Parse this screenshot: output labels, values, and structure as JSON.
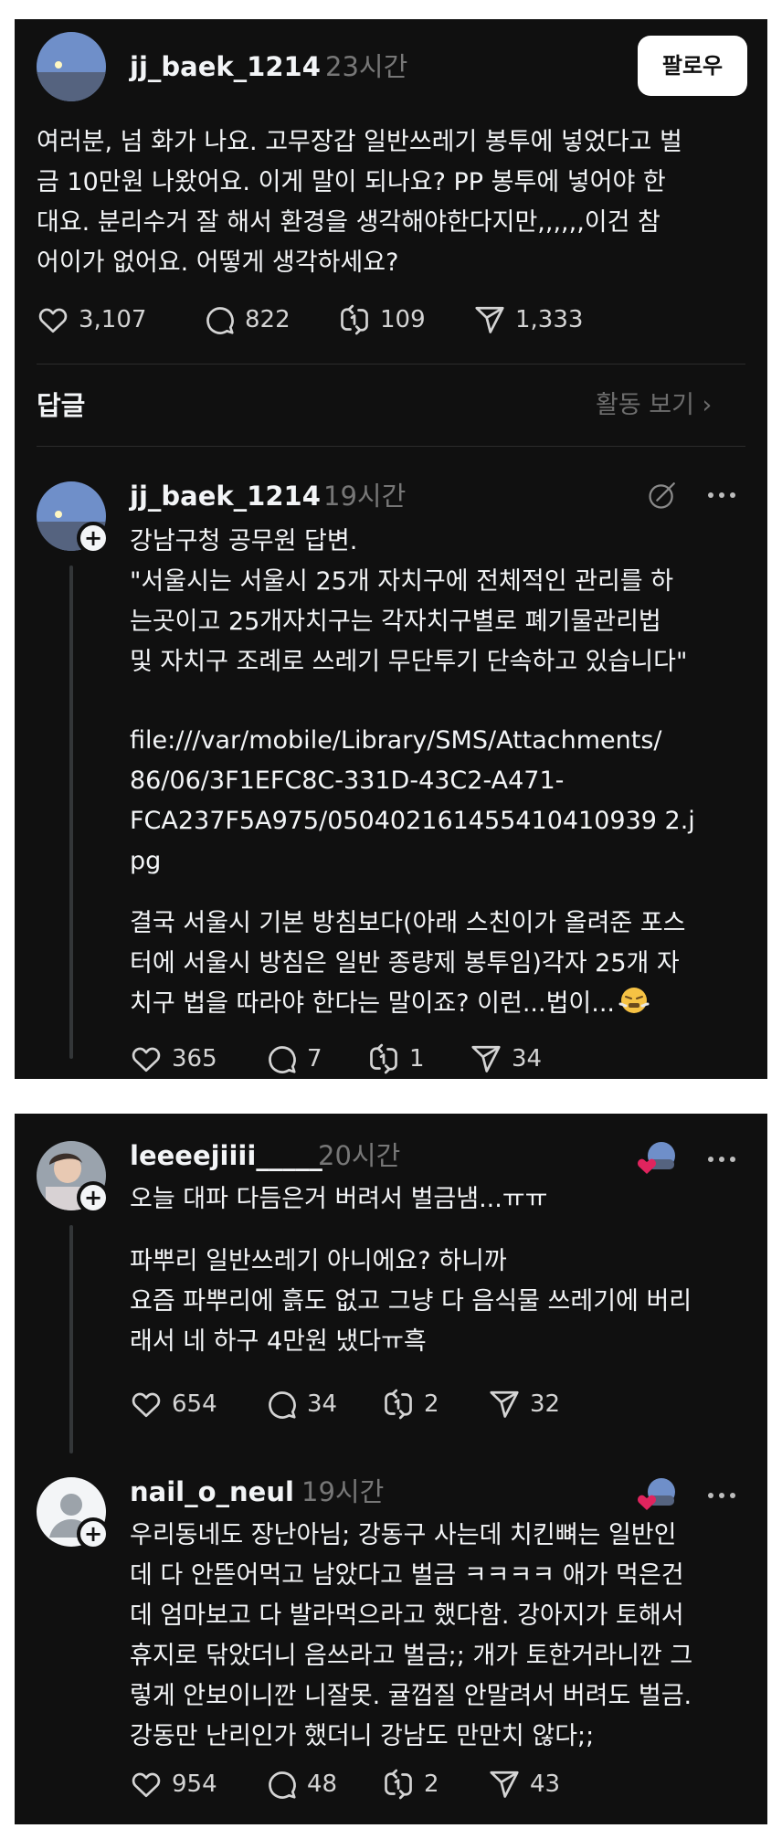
{
  "post": {
    "username": "jj_baek_1214",
    "time": "23시간",
    "follow_label": "팔로우",
    "text_lines": [
      "여러분, 넘 화가 나요. 고무장갑 일반쓰레기 봉투에 넣었다고 벌",
      "금 10만원 나왔어요. 이게 말이 되나요? PP 봉투에 넣어야 한",
      "대요. 분리수거 잘 해서 환경을 생각해야한다지만,,,,,,이건 참",
      "어이가 없어요. 어떻게 생각하세요?"
    ],
    "likes": "3,107",
    "comments": "822",
    "reposts": "109",
    "shares": "1,333"
  },
  "replies_header": {
    "title": "답글",
    "activity_label": "활동 보기 ›"
  },
  "reply1": {
    "username": "jj_baek_1214",
    "time": "19시간",
    "p1": [
      "강남구청 공무원 답변.",
      "\"서울시는 서울시 25개 자치구에 전체적인 관리를 하",
      "는곳이고  25개자치구는  각자치구별로 폐기물관리법",
      "및 자치구 조례로 쓰레기 무단투기 단속하고 있습니다\""
    ],
    "p2": [
      "file:///var/mobile/Library/SMS/Attachments/",
      "86/06/3F1EFC8C-331D-43C2-A471-",
      "FCA237F5A975/050402161455410410939 2.j",
      "pg"
    ],
    "p3": [
      "결국 서울시 기본 방침보다(아래 스친이가 올려준 포스",
      "터에 서울시 방침은 일반 종량제 봉투임)각자 25개 자",
      "치구 법을 따라야 한다는 말이죠? 이런...법이..."
    ],
    "emoji": "😤",
    "likes": "365",
    "comments": "7",
    "reposts": "1",
    "shares": "34"
  },
  "reply2": {
    "username": "leeeejiiii_____",
    "time": "20시간",
    "p1": [
      "오늘 대파 다듬은거 버려서 벌금냄...ㅠㅠ"
    ],
    "p2": [
      "파뿌리 일반쓰레기 아니에요? 하니까",
      "요즘 파뿌리에 흙도 없고 그냥 다 음식물 쓰레기에 버리",
      "래서 네 하구 4만원 냈다ㅠ흑"
    ],
    "likes": "654",
    "comments": "34",
    "reposts": "2",
    "shares": "32"
  },
  "reply3": {
    "username": "nail_o_neul",
    "time": "19시간",
    "p1": [
      "우리동네도 장난아님; 강동구 사는데 치킨뼈는 일반인",
      "데 다 안뜯어먹고 남았다고 벌금 ㅋㅋㅋㅋ 애가 먹은건",
      "데 엄마보고 다 발라먹으라고 했다함. 강아지가 토해서",
      "휴지로 닦았더니 음쓰라고 벌금;; 개가 토한거라니깐 그",
      "렇게 안보이니깐 니잘못. 귤껍질 안말려서 버려도 벌금.",
      "강동만 난리인가 했더니 강남도 만만치 않다;;"
    ],
    "likes": "954",
    "comments": "48",
    "reposts": "2",
    "shares": "43"
  },
  "colors": {
    "background": "#101010",
    "text": "#f3f5f7",
    "muted": "#777777",
    "heart": "#e0245e"
  }
}
